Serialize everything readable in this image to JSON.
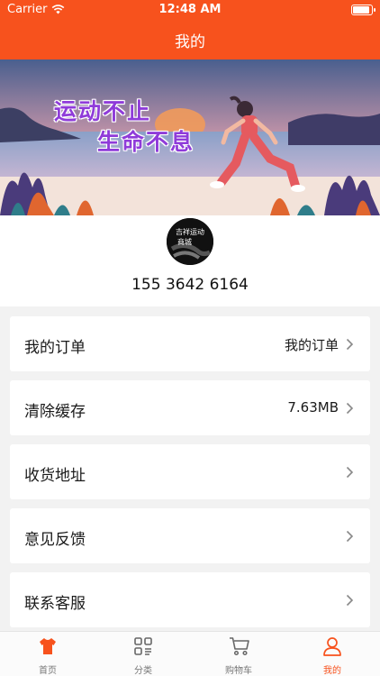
{
  "status_bar": {
    "carrier": "Carrier",
    "time": "12:48 AM",
    "battery_level": 0.95
  },
  "nav": {
    "title": "我的"
  },
  "banner": {
    "line1": "运动不止",
    "line2": "生命不息"
  },
  "profile": {
    "avatar_text_1": "吉祥运动",
    "avatar_text_2": "商城",
    "phone": "155 3642 6164"
  },
  "menu": [
    {
      "label": "我的订单",
      "value": "我的订单"
    },
    {
      "label": "清除缓存",
      "value": "7.63MB"
    },
    {
      "label": "收货地址",
      "value": ""
    },
    {
      "label": "意见反馈",
      "value": ""
    },
    {
      "label": "联系客服",
      "value": ""
    }
  ],
  "tabs": [
    {
      "label": "首页",
      "icon": "shirt-icon"
    },
    {
      "label": "分类",
      "icon": "grid-icon"
    },
    {
      "label": "购物车",
      "icon": "cart-icon"
    },
    {
      "label": "我的",
      "icon": "person-icon"
    }
  ],
  "colors": {
    "accent": "#f7521d",
    "background": "#f2f2f2",
    "slogan": "#8f3bd9"
  }
}
